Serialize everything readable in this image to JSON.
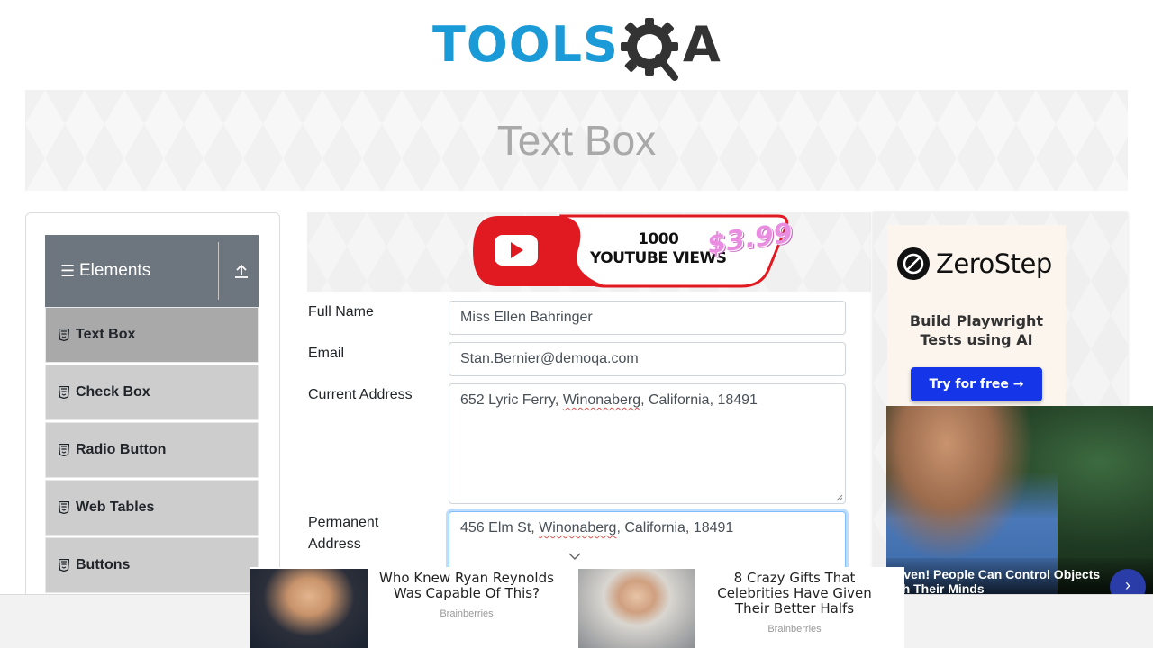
{
  "header": {
    "logo_tools": "TOOLS",
    "logo_a": "A"
  },
  "banner": {
    "title": "Text Box"
  },
  "sidebar": {
    "group_title": "Elements",
    "items": [
      {
        "label": "Text Box",
        "active": true
      },
      {
        "label": "Check Box"
      },
      {
        "label": "Radio Button"
      },
      {
        "label": "Web Tables"
      },
      {
        "label": "Buttons"
      }
    ]
  },
  "center_ad": {
    "line1": "1000",
    "line2": "YOUTUBE VIEWS",
    "price": "$3.99"
  },
  "form": {
    "full_name": {
      "label": "Full Name",
      "value": "Miss Ellen Bahringer"
    },
    "email": {
      "label": "Email",
      "value": "Stan.Bernier@demoqa.com"
    },
    "current_address": {
      "label": "Current Address",
      "pre": "652 Lyric Ferry, ",
      "word": "Winonaberg",
      "post": ", California, 18491"
    },
    "permanent_address": {
      "label_line1": "Permanent",
      "label_line2": "Address",
      "pre": "456 Elm St, ",
      "word": "Winonaberg",
      "post": ", California, 18491"
    }
  },
  "right_ad": {
    "brand": "ZeroStep",
    "tagline_line1": "Build Playwright",
    "tagline_line2": "Tests using AI",
    "cta": "Try for free →",
    "video_caption_line1": "Proven! People Can Control Objects",
    "video_caption_line2": "With Their Minds"
  },
  "bottom_ad": {
    "card1": {
      "title_line1": "Who Knew Ryan Reynolds",
      "title_line2": "Was Capable Of This?",
      "source": "Brainberries"
    },
    "card2": {
      "title_line1": "8 Crazy Gifts That",
      "title_line2": "Celebrities Have Given",
      "title_line3": "Their Better Halfs",
      "source": "Brainberries"
    }
  },
  "colors": {
    "brand_blue": "#1a9ad6",
    "menu_header": "#6d757e",
    "menu_item": "#cdcdcd",
    "menu_active": "#a9a9a9",
    "cta_blue": "#1536e8",
    "focus_border": "#80bdff"
  }
}
